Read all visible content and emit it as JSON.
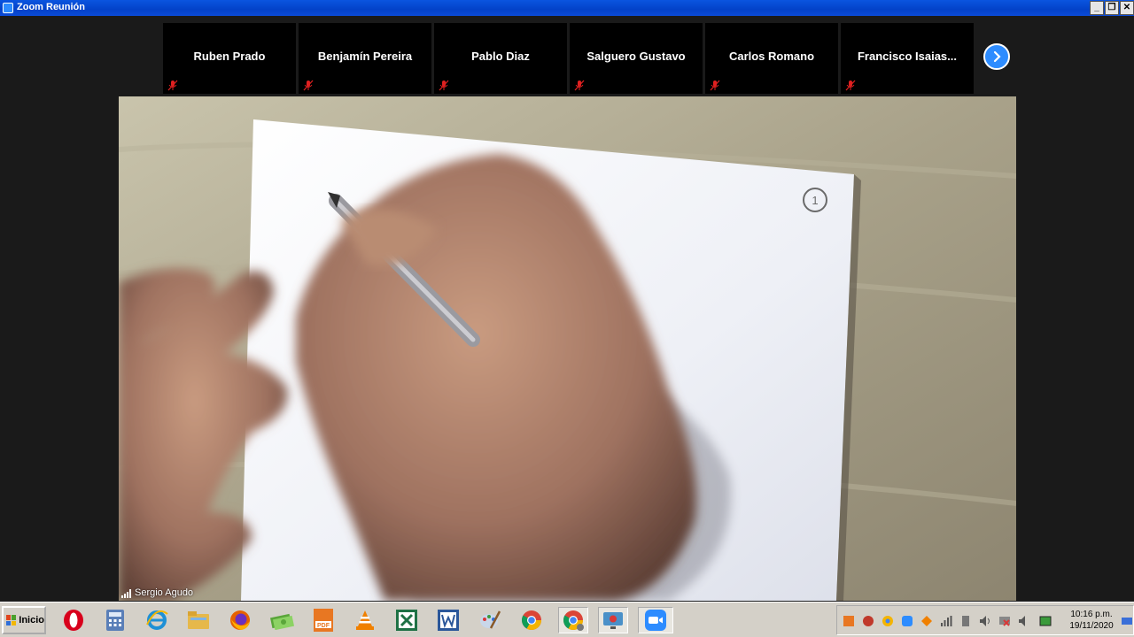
{
  "window": {
    "title": "Zoom Reunión",
    "controls": [
      "_",
      "❐",
      "✕"
    ]
  },
  "gallery": {
    "participants": [
      {
        "name": "Ruben Prado",
        "muted": true
      },
      {
        "name": "Benjamín Pereira",
        "muted": true
      },
      {
        "name": "Pablo Diaz",
        "muted": true
      },
      {
        "name": "Salguero Gustavo",
        "muted": true
      },
      {
        "name": "Carlos Romano",
        "muted": true
      },
      {
        "name": "Francisco  Isaias...",
        "muted": true
      }
    ],
    "next_icon": "chevron-right-icon"
  },
  "main_video": {
    "speaker_name": "Sergio Agudo",
    "page_mark": "1"
  },
  "taskbar": {
    "start_label": "Inicio",
    "apps": [
      {
        "name": "opera-icon",
        "color": "#d8001c"
      },
      {
        "name": "calculator-icon",
        "color": "#5a7fb8"
      },
      {
        "name": "internet-explorer-icon",
        "color": "#1e90d6"
      },
      {
        "name": "file-explorer-icon",
        "color": "#e6b84a"
      },
      {
        "name": "firefox-icon",
        "color": "#e66000"
      },
      {
        "name": "cash-icon",
        "color": "#5aa63a"
      },
      {
        "name": "pdf-icon",
        "color": "#e87722"
      },
      {
        "name": "vlc-icon",
        "color": "#f08000"
      },
      {
        "name": "excel-icon",
        "color": "#1e7145"
      },
      {
        "name": "word-icon",
        "color": "#2b579a"
      },
      {
        "name": "paint-icon",
        "color": "#7c9bc4"
      },
      {
        "name": "chrome-icon",
        "color": "#4285f4"
      },
      {
        "name": "chrome-user-icon",
        "color": "#4285f4",
        "active": true
      },
      {
        "name": "screen-recorder-icon",
        "color": "#d93838",
        "active": true
      },
      {
        "name": "zoom-icon",
        "color": "#2d8cff",
        "active": true
      }
    ],
    "clock": {
      "time": "10:16 p.m.",
      "date": "19/11/2020"
    }
  },
  "colors": {
    "titlebar": "#0342c8",
    "zoom_blue": "#2d8cff",
    "taskbar": "#d4d0c8",
    "mic_off_red": "#e02020"
  }
}
